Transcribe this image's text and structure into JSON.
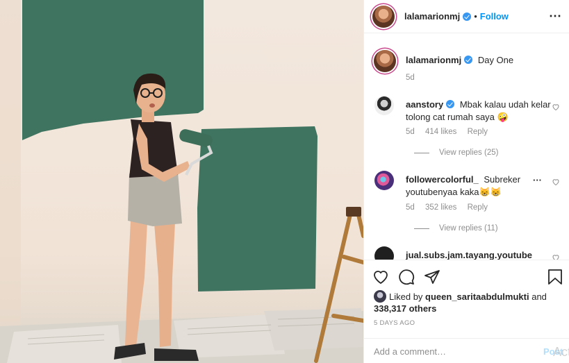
{
  "post": {
    "author": "lalamarionmj",
    "follow_label": "Follow",
    "separator": "•",
    "caption": "Day One",
    "caption_age": "5d"
  },
  "comments": [
    {
      "user": "aanstory",
      "verified": true,
      "text": "Mbak kalau udah kelar tolong cat rumah saya 🤪",
      "age": "5d",
      "likes": "414 likes",
      "reply_label": "Reply",
      "view_replies": "View replies (25)"
    },
    {
      "user": "followercolorful_",
      "verified": false,
      "text": "Subreker youtubenyaa kaka😸😸",
      "age": "5d",
      "likes": "352 likes",
      "reply_label": "Reply",
      "view_replies": "View replies (11)"
    },
    {
      "user": "jual.subs.jam.tayang.youtube",
      "verified": false,
      "text": ""
    }
  ],
  "actions": {
    "liked_by_prefix": "Liked by",
    "liked_by_user": "queen_saritaabdulmukti",
    "and_label": "and",
    "others": "338,317 others",
    "date": "5 DAYS AGO",
    "comment_placeholder": "Add a comment…",
    "post_label": "Post",
    "watermark": "Act"
  },
  "icons": {
    "verified": "verified-badge-icon",
    "more": "more-options-icon",
    "heart": "heart-icon",
    "comment": "comment-icon",
    "share": "share-icon",
    "save": "bookmark-icon"
  },
  "colors": {
    "accent": "#0095f6",
    "verified": "#3897f0",
    "muted": "#8e8e8e",
    "wall_paint": "#3f7460"
  }
}
